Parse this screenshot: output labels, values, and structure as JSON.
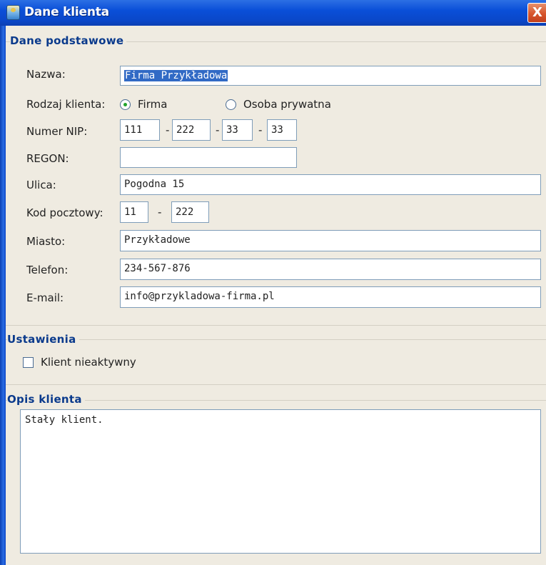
{
  "window": {
    "title": "Dane klienta",
    "close_symbol": "X",
    "icon": "app-icon"
  },
  "basic_group": {
    "title": "Dane podstawowe",
    "name_label": "Nazwa:",
    "name_value": "Firma Przykładowa",
    "client_type_label": "Rodzaj klienta:",
    "client_type_options": [
      "Firma",
      "Osoba prywatna"
    ],
    "client_type_selected": "Firma",
    "nip_label": "Numer NIP:",
    "nip_parts": [
      "111",
      "222",
      "33",
      "33"
    ],
    "separator": "-",
    "regon_label": "REGON:",
    "regon_value": "",
    "street_label": "Ulica:",
    "street_value": "Pogodna 15",
    "postal_label": "Kod pocztowy:",
    "postal_parts": [
      "11",
      "222"
    ],
    "city_label": "Miasto:",
    "city_value": "Przykładowe",
    "phone_label": "Telefon:",
    "phone_value": "234-567-876",
    "email_label": "E-mail:",
    "email_value": "info@przykladowa-firma.pl"
  },
  "settings_group": {
    "title": "Ustawienia",
    "inactive_label": "Klient nieaktywny",
    "inactive_checked": false
  },
  "description_group": {
    "title": "Opis klienta",
    "text": "Stały klient."
  },
  "colors": {
    "titlebar": "#0a4fd8",
    "window_bg": "#efebe1",
    "group_title": "#0a3a8c",
    "field_border": "#7f9db9",
    "selection": "#316ac5",
    "radio_dot": "#22a32b"
  }
}
